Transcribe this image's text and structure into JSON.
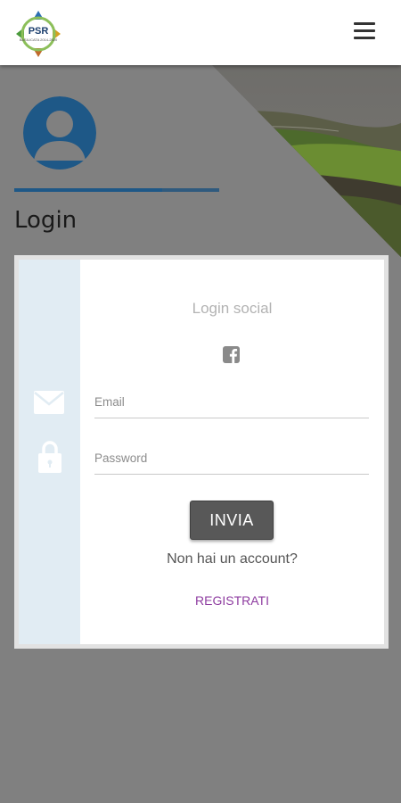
{
  "header": {
    "logo_text": "PSR",
    "logo_subtext": "BASILICATA 2014-2020",
    "menu_icon": "hamburger-menu-icon"
  },
  "profile": {
    "avatar_icon": "user-avatar-icon",
    "progress": 0.72,
    "title": "Login"
  },
  "login_card": {
    "social_title": "Login social",
    "facebook_icon": "facebook-icon",
    "email_placeholder": "Email",
    "password_placeholder": "Password",
    "email_icon": "mail-icon",
    "password_icon": "lock-icon",
    "submit_label": "INVIA",
    "no_account_text": "Non hai un account?",
    "register_label": "REGISTRATI"
  },
  "colors": {
    "background": "#808080",
    "accent": "#1e5887",
    "link": "#8e3ca0",
    "button": "#585858",
    "side_panel": "#e1ecf3"
  }
}
